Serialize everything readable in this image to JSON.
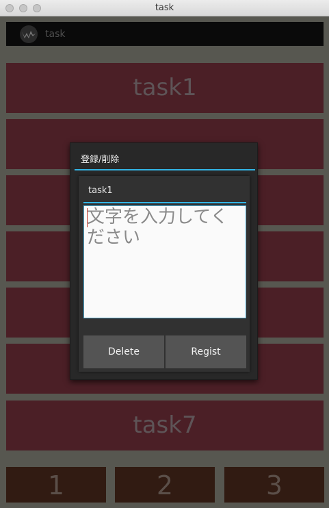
{
  "window": {
    "title": "task"
  },
  "actionbar": {
    "title": "task",
    "logo_icon": "app-logo-icon"
  },
  "tasks": [
    {
      "label": "task1"
    },
    {
      "label": ""
    },
    {
      "label": ""
    },
    {
      "label": ""
    },
    {
      "label": ""
    },
    {
      "label": ""
    },
    {
      "label": "task7"
    }
  ],
  "tabs": [
    {
      "label": "1"
    },
    {
      "label": "2"
    },
    {
      "label": "3"
    }
  ],
  "dialog": {
    "title": "登録/削除",
    "field_label": "task1",
    "text_value": "",
    "text_placeholder": "文字を入力してください",
    "delete_label": "Delete",
    "regist_label": "Regist"
  },
  "colors": {
    "accent": "#33b5e5",
    "task_bg": "#4b1f26",
    "tab_bg": "#311b12",
    "app_bg": "#575750"
  }
}
